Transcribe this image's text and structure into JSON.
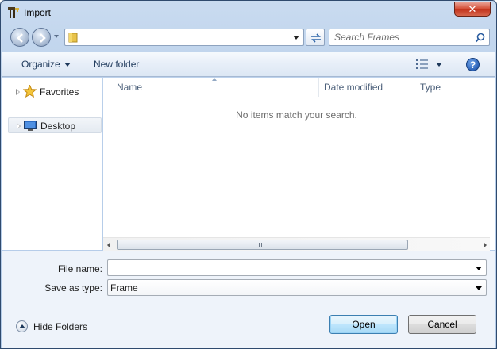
{
  "window": {
    "title": "Import",
    "close_glyph": "✕"
  },
  "address_bar": {
    "path": "",
    "folder_icon": "folder-icon"
  },
  "search": {
    "placeholder": "Search Frames"
  },
  "toolbar": {
    "organize_label": "Organize",
    "new_folder_label": "New folder",
    "help_glyph": "?"
  },
  "nav_pane": {
    "items": [
      {
        "label": "Favorites",
        "icon": "star-icon"
      },
      {
        "label": "Desktop",
        "icon": "desktop-icon"
      }
    ]
  },
  "file_list": {
    "columns": [
      "Name",
      "Date modified",
      "Type"
    ],
    "empty_message": "No items match your search."
  },
  "form": {
    "file_name_label": "File name:",
    "file_name_value": "",
    "save_type_label": "Save as type:",
    "save_type_value": "Frame"
  },
  "footer": {
    "hide_folders_label": "Hide Folders",
    "open_label": "Open",
    "cancel_label": "Cancel"
  },
  "colors": {
    "window_frame": "#b9cfea",
    "toolbar_text": "#1e395b",
    "close_button": "#c1311b",
    "open_button_border": "#3c7fb1"
  }
}
